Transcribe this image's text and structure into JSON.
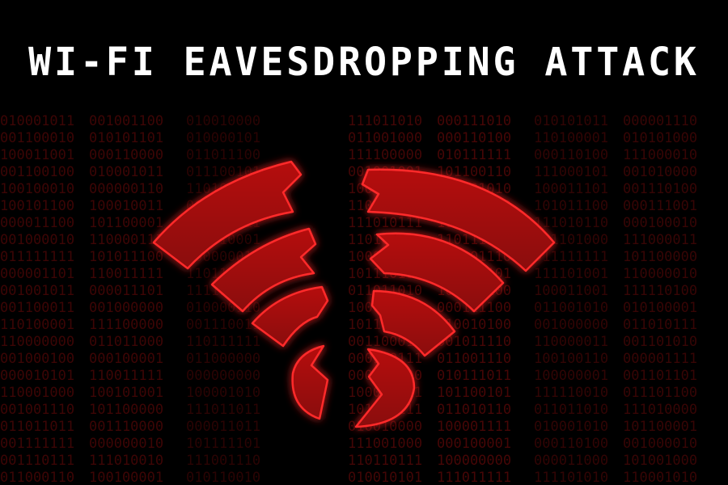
{
  "title": "WI-FI EAVESDROPPING ATTACK",
  "colors": {
    "background": "#000000",
    "title": "#ffffff",
    "wifi_fill": "#a00d0d",
    "wifi_glow": "#ff1a1a",
    "binary": "#6e0a0a"
  },
  "icons": [
    "broken-wifi-icon"
  ]
}
